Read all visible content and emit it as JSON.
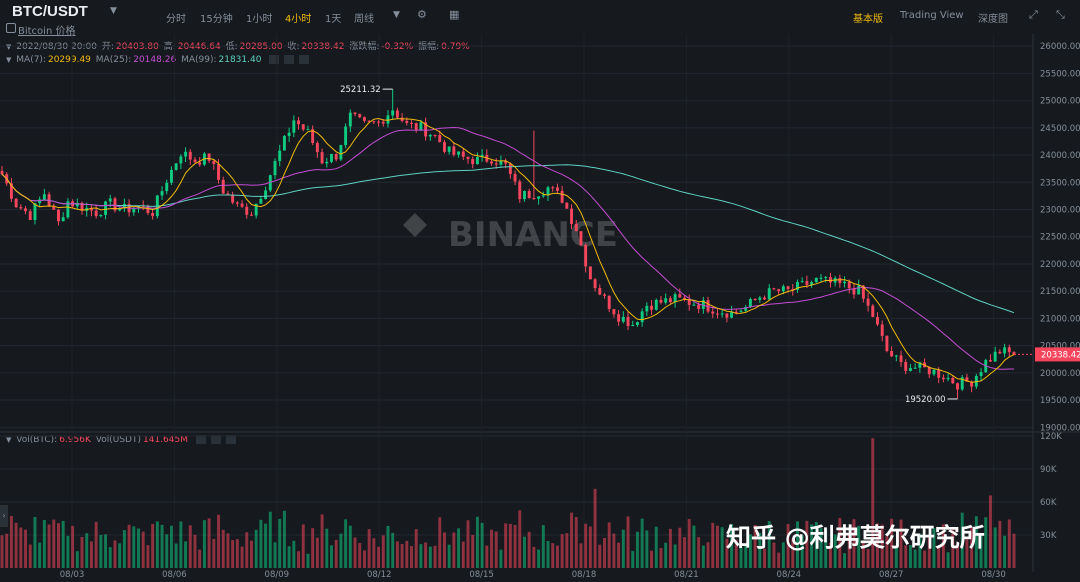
{
  "header": {
    "symbol": "BTC/USDT",
    "subtitle": "Bitcoin 价格",
    "timeframes": [
      "分时",
      "15分钟",
      "1小时",
      "4小时",
      "1天",
      "周线"
    ],
    "active_timeframe": "4小时",
    "views": [
      "基本版",
      "Trading View",
      "深度图"
    ],
    "active_view": "基本版"
  },
  "ohlc": {
    "date": "2022/08/30 20:00",
    "open_label": "开:",
    "open": "20403.80",
    "high_label": "高:",
    "high": "20446.64",
    "low_label": "低:",
    "low": "20285.00",
    "close_label": "收:",
    "close": "20338.42",
    "change_label": "涨跌幅:",
    "change": "-0.32%",
    "amp_label": "振幅:",
    "amp": "0.79%"
  },
  "ma": {
    "ma7_label": "MA(7):",
    "ma7": "20299.49",
    "ma25_label": "MA(25):",
    "ma25": "20148.26",
    "ma99_label": "MA(99):",
    "ma99": "21831.40"
  },
  "vol": {
    "label1": "Vol(BTC):",
    "v1": "6.956K",
    "label2": "Vol(USDT)",
    "v2": "141.645M"
  },
  "watermark": "知乎 @利弗莫尔研究所",
  "colors": {
    "up": "#0ecb81",
    "down": "#f6465d",
    "ma7": "#f0b90b",
    "ma25": "#c54cd3",
    "ma99": "#5fd0c2",
    "bg": "#161a1e"
  },
  "chart_data": {
    "type": "candlestick",
    "y_ticks": [
      "26000.00",
      "25500.00",
      "25000.00",
      "24500.00",
      "24000.00",
      "23500.00",
      "23000.00",
      "22500.00",
      "22000.00",
      "21500.00",
      "21000.00",
      "20500.00",
      "20000.00",
      "19500.00",
      "19000.00"
    ],
    "vol_ticks": [
      "120K",
      "90K",
      "60K",
      "30K"
    ],
    "x_labels": [
      "08/03",
      "08/06",
      "08/09",
      "08/12",
      "08/15",
      "08/18",
      "08/21",
      "08/24",
      "08/27",
      "08/30"
    ],
    "ylim": [
      18950,
      26150
    ],
    "high_label": "25211.32",
    "low_label": "19520.00",
    "last_price": "20338.42",
    "anchors": [
      [
        0,
        23650
      ],
      [
        3,
        23100
      ],
      [
        6,
        22900
      ],
      [
        9,
        23300
      ],
      [
        12,
        22750
      ],
      [
        14,
        23150
      ],
      [
        17,
        23050
      ],
      [
        20,
        22950
      ],
      [
        23,
        23100
      ],
      [
        26,
        23000
      ],
      [
        29,
        23050
      ],
      [
        32,
        22950
      ],
      [
        35,
        23550
      ],
      [
        38,
        24050
      ],
      [
        41,
        23900
      ],
      [
        44,
        23950
      ],
      [
        47,
        23350
      ],
      [
        50,
        23050
      ],
      [
        53,
        22950
      ],
      [
        56,
        23450
      ],
      [
        59,
        24050
      ],
      [
        62,
        24650
      ],
      [
        65,
        24400
      ],
      [
        68,
        23900
      ],
      [
        71,
        24000
      ],
      [
        74,
        24700
      ],
      [
        77,
        24550
      ],
      [
        80,
        24600
      ],
      [
        83,
        24850
      ],
      [
        86,
        24550
      ],
      [
        89,
        24500
      ],
      [
        92,
        24350
      ],
      [
        95,
        24050
      ],
      [
        98,
        23950
      ],
      [
        101,
        23900
      ],
      [
        104,
        23950
      ],
      [
        107,
        23800
      ],
      [
        110,
        23250
      ],
      [
        113,
        23300
      ],
      [
        116,
        23400
      ],
      [
        119,
        23200
      ],
      [
        122,
        22650
      ],
      [
        125,
        21750
      ],
      [
        128,
        21350
      ],
      [
        131,
        21050
      ],
      [
        134,
        20900
      ],
      [
        137,
        21250
      ],
      [
        140,
        21300
      ],
      [
        143,
        21350
      ],
      [
        146,
        21300
      ],
      [
        149,
        21250
      ],
      [
        152,
        21150
      ],
      [
        155,
        21100
      ],
      [
        158,
        21200
      ],
      [
        161,
        21400
      ],
      [
        164,
        21500
      ],
      [
        167,
        21500
      ],
      [
        170,
        21600
      ],
      [
        173,
        21700
      ],
      [
        176,
        21650
      ],
      [
        179,
        21600
      ],
      [
        182,
        21500
      ],
      [
        185,
        21050
      ],
      [
        188,
        20400
      ],
      [
        191,
        20150
      ],
      [
        194,
        20100
      ],
      [
        197,
        20050
      ],
      [
        200,
        19950
      ],
      [
        203,
        19800
      ],
      [
        206,
        19850
      ],
      [
        209,
        20200
      ],
      [
        212,
        20400
      ],
      [
        215,
        20338
      ]
    ],
    "candle_count": 216
  }
}
